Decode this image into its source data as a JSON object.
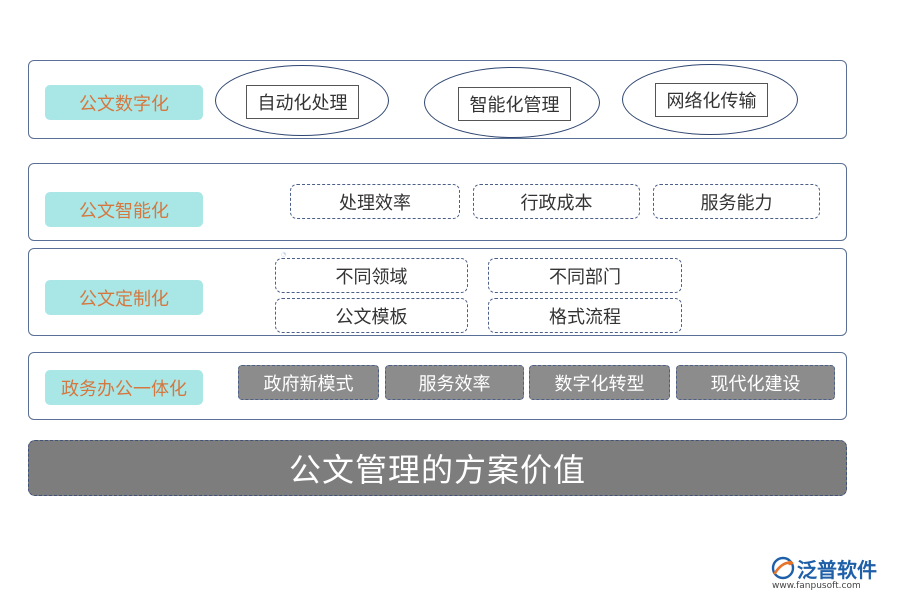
{
  "rows": {
    "digital": {
      "label": "公文数字化",
      "items": [
        "自动化处理",
        "智能化管理",
        "网络化传输"
      ]
    },
    "intelligent": {
      "label": "公文智能化",
      "items": [
        "处理效率",
        "行政成本",
        "服务能力"
      ]
    },
    "custom": {
      "label": "公文定制化",
      "items": [
        "不同领域",
        "不同部门",
        "公文模板",
        "格式流程"
      ]
    },
    "integration": {
      "label": "政务办公一体化",
      "items": [
        "政府新模式",
        "服务效率",
        "数字化转型",
        "现代化建设"
      ]
    }
  },
  "banner": "公文管理的方案价值",
  "logo": {
    "name": "泛普软件",
    "url": "www.fanpusoft.com"
  },
  "colors": {
    "tag_bg": "#a8e7e6",
    "tag_text": "#d5773f",
    "panel_border": "#5a6f95",
    "gray_box": "#8c8c8c",
    "banner_bg": "#7d7d7d",
    "logo_blue": "#1e5fa8",
    "logo_orange": "#e8742a"
  }
}
